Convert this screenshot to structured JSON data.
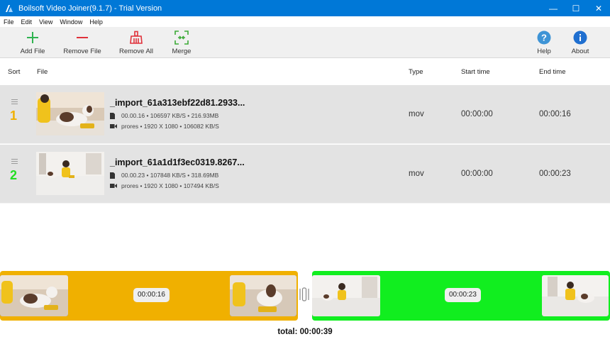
{
  "window": {
    "title": "Boilsoft Video Joiner(9.1.7) - Trial Version",
    "controls": {
      "minimize": "—",
      "maximize": "☐",
      "close": "✕"
    }
  },
  "menu": [
    "File",
    "Edit",
    "View",
    "Window",
    "Help"
  ],
  "toolbar": {
    "add_file": "Add File",
    "remove_file": "Remove File",
    "remove_all": "Remove All",
    "merge": "Merge",
    "help": "Help",
    "about": "About"
  },
  "colors": {
    "titlebar": "#0078d7",
    "add_icon": "#2fb350",
    "remove_icon": "#e0313a",
    "merge_icon": "#3aa935",
    "info_icon": "#3e94d6",
    "clip1": "#f0b000",
    "clip2": "#11ee1f"
  },
  "columns": {
    "sort": "Sort",
    "file": "File",
    "type": "Type",
    "start": "Start time",
    "end": "End time"
  },
  "files": [
    {
      "num": "1",
      "num_color": "#f0b000",
      "name": "_import_61a313ebf22d81.2933...",
      "info": "00.00.16 • 106597 KB/S • 216.93MB",
      "video": "prores • 1920 X 1080 • 106082 KB/S",
      "type": "mov",
      "start": "00:00:00",
      "end": "00:00:16"
    },
    {
      "num": "2",
      "num_color": "#22dd22",
      "name": "_import_61a1d1f3ec0319.8267...",
      "info": "00.00.23 • 107848 KB/S • 318.69MB",
      "video": "prores • 1920 X 1080 • 107494 KB/S",
      "type": "mov",
      "start": "00:00:00",
      "end": "00:00:23"
    }
  ],
  "timeline": {
    "clip1_duration": "00:00:16",
    "clip2_duration": "00:00:23"
  },
  "total": "total: 00:00:39"
}
